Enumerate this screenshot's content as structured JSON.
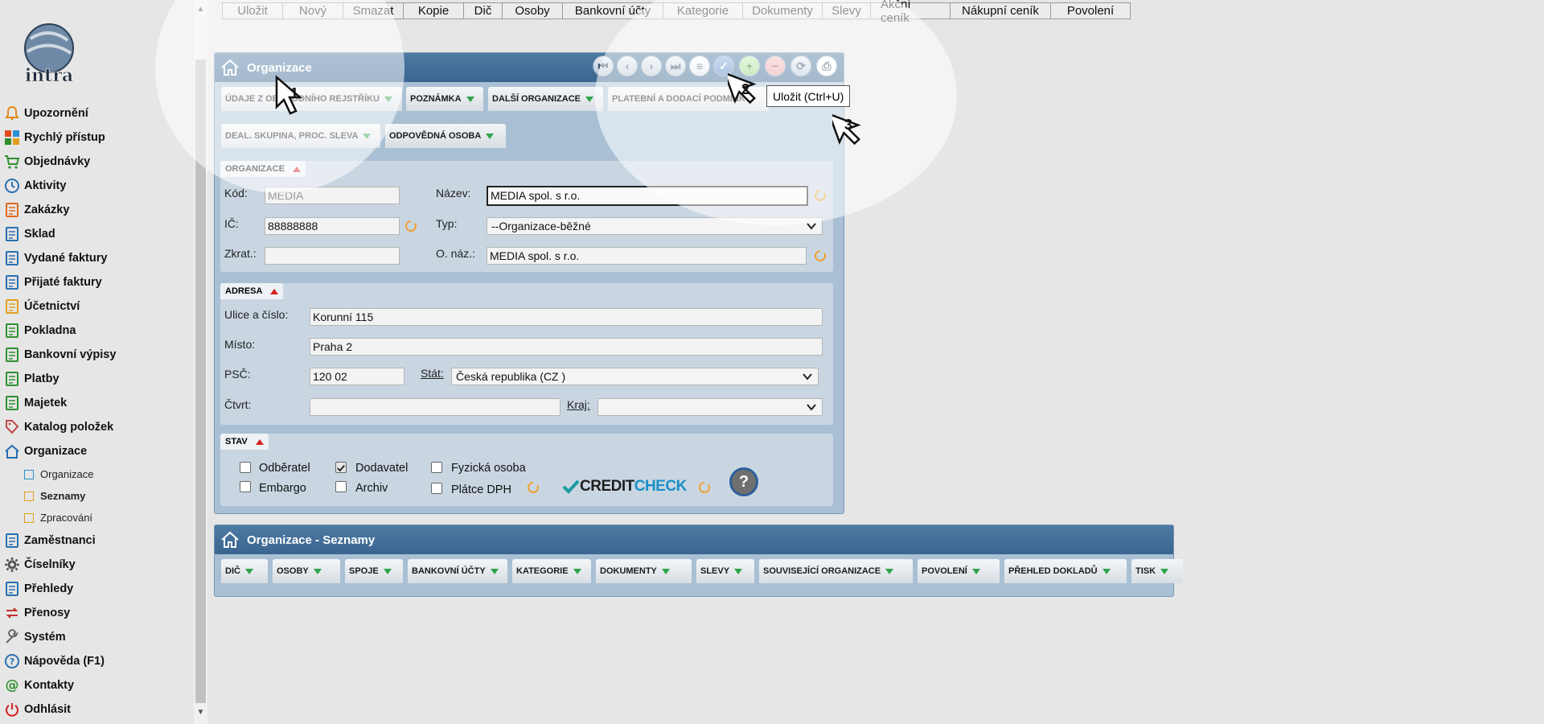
{
  "logo": {
    "name": "intra-logo",
    "text": "intra"
  },
  "sidebar": {
    "items": [
      {
        "label": "Upozornění",
        "icon": "bell-icon",
        "color": "#e08a1e"
      },
      {
        "label": "Rychlý přístup",
        "icon": "tiles-icon",
        "color": "#e04a1e"
      },
      {
        "label": "Objednávky",
        "icon": "cart-icon",
        "color": "#2f8f2f"
      },
      {
        "label": "Aktivity",
        "icon": "clock-icon",
        "color": "#2a6fb0"
      },
      {
        "label": "Zakázky",
        "icon": "clipboard-icon",
        "color": "#e06a1e"
      },
      {
        "label": "Sklad",
        "icon": "warehouse-icon",
        "color": "#2a6fb0"
      },
      {
        "label": "Vydané faktury",
        "icon": "invoice-out-icon",
        "color": "#2a6fb0"
      },
      {
        "label": "Přijaté faktury",
        "icon": "invoice-in-icon",
        "color": "#2a6fb0"
      },
      {
        "label": "Účetnictví",
        "icon": "ledger-icon",
        "color": "#e0a01e"
      },
      {
        "label": "Pokladna",
        "icon": "cashbox-icon",
        "color": "#2f8f2f"
      },
      {
        "label": "Bankovní výpisy",
        "icon": "bank-icon",
        "color": "#2f8f2f"
      },
      {
        "label": "Platby",
        "icon": "payment-icon",
        "color": "#2f8f2f"
      },
      {
        "label": "Majetek",
        "icon": "property-icon",
        "color": "#2f8f2f"
      },
      {
        "label": "Katalog položek",
        "icon": "tag-icon",
        "color": "#c04a4a"
      },
      {
        "label": "Organizace",
        "icon": "house-icon",
        "color": "#2a6fb0"
      }
    ],
    "sub_items": [
      {
        "label": "Organizace",
        "icon": "square-icon",
        "color": "#2a8fd0"
      },
      {
        "label": "Seznamy",
        "icon": "folder-icon",
        "color": "#e0a01e"
      },
      {
        "label": "Zpracování",
        "icon": "folder-icon",
        "color": "#e0a01e"
      }
    ],
    "items2": [
      {
        "label": "Zaměstnanci",
        "icon": "employees-icon",
        "color": "#2a6fb0"
      },
      {
        "label": "Číselníky",
        "icon": "gear-icon",
        "color": "#555555"
      },
      {
        "label": "Přehledy",
        "icon": "list-icon",
        "color": "#2a6fb0"
      },
      {
        "label": "Přenosy",
        "icon": "transfer-icon",
        "color": "#c03030"
      },
      {
        "label": "Systém",
        "icon": "wrench-icon",
        "color": "#666666"
      },
      {
        "label": "Nápověda (F1)",
        "icon": "help-icon",
        "color": "#2a6fb0"
      },
      {
        "label": "Kontakty",
        "icon": "at-icon",
        "color": "#2f8f2f"
      },
      {
        "label": "Odhlásit",
        "icon": "power-icon",
        "color": "#d02020"
      }
    ]
  },
  "toolbar": {
    "buttons": [
      "Uložit",
      "Nový",
      "Smazat",
      "Kopie",
      "Dič",
      "Osoby",
      "Bankovní účty",
      "Kategorie",
      "Dokumenty",
      "Slevy",
      "Akční ceník",
      "Nákupní ceník",
      "Povolení"
    ]
  },
  "org_window": {
    "title": "Organizace",
    "tabs_row1": [
      "ÚDAJE Z OBCHODNÍHO REJSTŘÍKU",
      "POZNÁMKA",
      "DALŠÍ ORGANIZACE",
      "PLATEBNÍ A DODACÍ PODMÍNKY"
    ],
    "tabs_row2": [
      "DEAL. SKUPINA, PROC. SLEVA",
      "ODPOVĚDNÁ OSOBA"
    ],
    "tooltip": "Uložit (Ctrl+U)",
    "section_org": {
      "title": "ORGANIZACE",
      "kod_label": "Kód:",
      "kod_value": "MEDIA",
      "nazev_label": "Název:",
      "nazev_value": "MEDIA spol. s r.o.",
      "ic_label": "IČ:",
      "ic_value": "88888888",
      "typ_label": "Typ:",
      "typ_value": "--Organizace-běžné",
      "zkrat_label": "Zkrat.:",
      "zkrat_value": "",
      "onaz_label": "O. náz.:",
      "onaz_value": "MEDIA spol. s r.o."
    },
    "section_addr": {
      "title": "ADRESA",
      "ulice_label": "Ulice a číslo:",
      "ulice_value": "Korunní 115",
      "misto_label": "Místo:",
      "misto_value": "Praha 2",
      "psc_label": "PSČ:",
      "psc_value": "120 02",
      "stat_label": "Stát:",
      "stat_value": "Česká republika (CZ )",
      "ctvrt_label": "Čtvrt:",
      "ctvrt_value": "",
      "kraj_label": "Kraj:",
      "kraj_value": ""
    },
    "section_stav": {
      "title": "STAV",
      "checkboxes": [
        {
          "label": "Odběratel",
          "checked": false
        },
        {
          "label": "Dodavatel",
          "checked": true
        },
        {
          "label": "Fyzická osoba",
          "checked": false
        },
        {
          "label": "Embargo",
          "checked": false
        },
        {
          "label": "Archiv",
          "checked": false
        },
        {
          "label": "Plátce DPH",
          "checked": false
        }
      ],
      "creditcheck_a": "CREDIT",
      "creditcheck_b": "CHECK"
    }
  },
  "list_window": {
    "title": "Organizace - Seznamy",
    "tabs": [
      "DIČ",
      "OSOBY",
      "SPOJE",
      "BANKOVNÍ ÚČTY",
      "KATEGORIE",
      "DOKUMENTY",
      "SLEVY",
      "SOUVISEJÍCÍ ORGANIZACE",
      "POVOLENÍ",
      "PŘEHLED DOKLADŮ",
      "TISK"
    ]
  },
  "annotations": [
    "1",
    "2",
    "3"
  ]
}
